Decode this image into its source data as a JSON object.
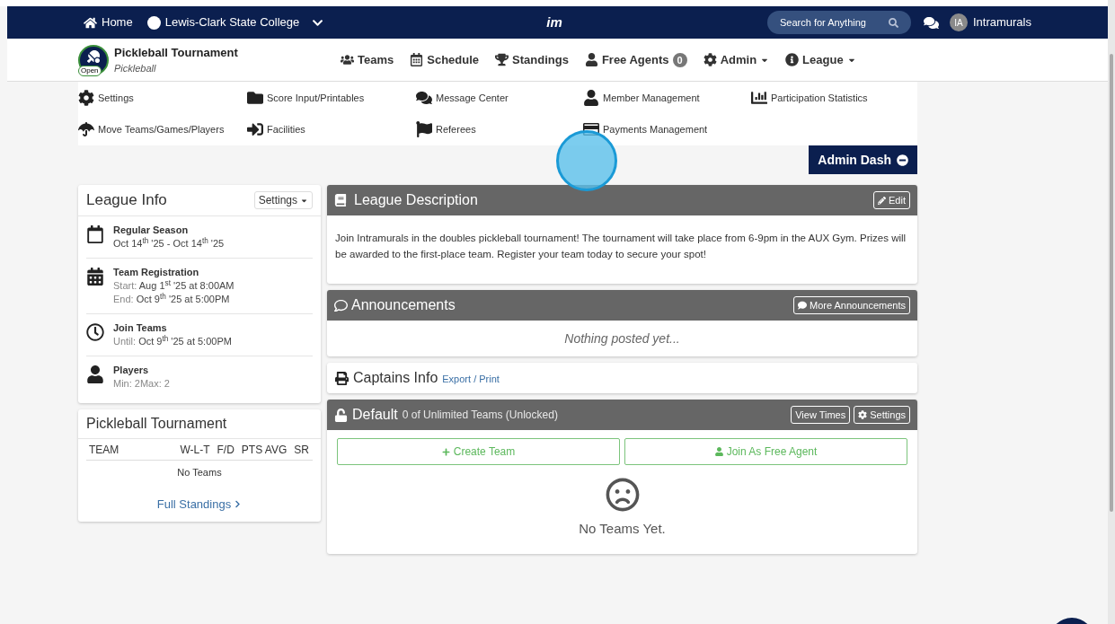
{
  "top_nav": {
    "home": "Home",
    "school": "Lewis-Clark State College",
    "logo": "im",
    "search": {
      "placeholder": "Search for Anything"
    },
    "avatar": "IA",
    "user": "Intramurals"
  },
  "league_header": {
    "title": "Pickleball Tournament",
    "sport": "Pickleball",
    "badge": "Open"
  },
  "main_nav": [
    {
      "label": "Teams",
      "kind": "link"
    },
    {
      "label": "Schedule",
      "kind": "link"
    },
    {
      "label": "Standings",
      "kind": "link"
    },
    {
      "label": "Free Agents",
      "kind": "count",
      "count": "0"
    },
    {
      "label": "Admin",
      "kind": "dropdown"
    },
    {
      "label": "League",
      "kind": "dropdown"
    }
  ],
  "admin_links": [
    {
      "label": "Settings"
    },
    {
      "label": "Score Input/Printables"
    },
    {
      "label": "Message Center"
    },
    {
      "label": "Member Management"
    },
    {
      "label": "Participation Statistics"
    },
    {
      "label": "Move Teams/Games/Players"
    },
    {
      "label": "Facilities"
    },
    {
      "label": "Referees"
    },
    {
      "label": "Payments Management"
    }
  ],
  "admin_dash": "Admin Dash",
  "league_info": {
    "title": "League Info",
    "settings_button": "Settings",
    "items": [
      {
        "title": "Regular Season",
        "lines": [
          {
            "value": "Oct 14$^{th}$ '25 - Oct 14$^{th}$ '25"
          }
        ]
      },
      {
        "title": "Team Registration",
        "lines": [
          {
            "label": "Start:",
            "value": "Aug 1$^{st}$ '25 at 8:00AM"
          },
          {
            "label": "End:",
            "value": "Oct 9$^{th}$ '25 at 5:00PM"
          }
        ]
      },
      {
        "title": "Join Teams",
        "lines": [
          {
            "label": "Until:",
            "value": "Oct 9$^{th}$ '25 at 5:00PM"
          }
        ]
      },
      {
        "title": "Players",
        "lines": [
          {
            "label": "Min: 2Max: 2"
          }
        ]
      }
    ]
  },
  "standings": {
    "title": "Pickleball Tournament",
    "columns": [
      "TEAM",
      "W-L-T",
      "F/D",
      "PTS AVG",
      "SR"
    ],
    "empty": "No Teams",
    "link": "Full Standings"
  },
  "description": {
    "title": "League Description",
    "edit": "Edit",
    "text": "Join Intramurals in the doubles pickleball tournament! The tournament will take place from 6-9pm in the AUX Gym. Prizes will be awarded to the first-place team. Register your team today to secure your spot!"
  },
  "announcements": {
    "title": "Announcements",
    "button": "More Announcements",
    "empty": "Nothing posted yet..."
  },
  "captains": {
    "title": "Captains Info",
    "link": "Export / Print"
  },
  "division": {
    "title": "Default",
    "subtitle": "0 of Unlimited Teams (Unlocked)",
    "buttons": [
      "View Times",
      "Settings"
    ],
    "create": "Create Team",
    "join": "Join As Free Agent",
    "empty": "No Teams Yet."
  }
}
